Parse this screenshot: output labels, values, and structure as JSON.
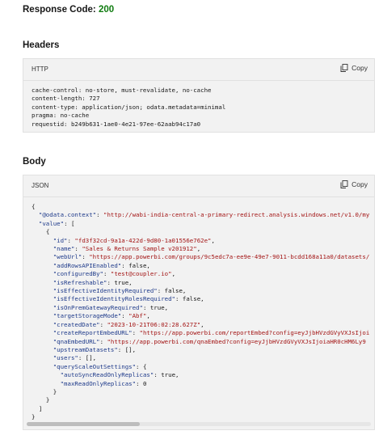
{
  "response": {
    "label": "Response Code: ",
    "code": "200"
  },
  "headers": {
    "title": "Headers",
    "lang": "HTTP",
    "copy_label": "Copy",
    "lines": [
      "cache-control: no-store, must-revalidate, no-cache",
      "content-length: 727",
      "content-type: application/json; odata.metadata=minimal",
      "pragma: no-cache",
      "requestid: b249b631-1ae0-4e21-97ee-62aab94c17a0"
    ]
  },
  "body": {
    "title": "Body",
    "lang": "JSON",
    "copy_label": "Copy",
    "lines": [
      {
        "t": "p",
        "v": "{"
      },
      {
        "i": "  ",
        "k": "\"@odata.context\"",
        "sep": ": ",
        "s": "\"http://wabi-india-central-a-primary-redirect.analysis.windows.net/v1.0/my"
      },
      {
        "i": "  ",
        "k": "\"value\"",
        "sep": ": ["
      },
      {
        "i": "    ",
        "t": "p",
        "v": "{"
      },
      {
        "i": "      ",
        "k": "\"id\"",
        "sep": ": ",
        "s": "\"fd3f32cd-9a1a-422d-9d80-1a01556e762e\"",
        "end": ","
      },
      {
        "i": "      ",
        "k": "\"name\"",
        "sep": ": ",
        "s": "\"Sales & Returns Sample v201912\"",
        "end": ","
      },
      {
        "i": "      ",
        "k": "\"webUrl\"",
        "sep": ": ",
        "s": "\"https://app.powerbi.com/groups/9c5edc7a-ee9e-49e7-9011-bcdd168a11a0/datasets/"
      },
      {
        "i": "      ",
        "k": "\"addRowsAPIEnabled\"",
        "sep": ": ",
        "n": "false",
        "end": ","
      },
      {
        "i": "      ",
        "k": "\"configuredBy\"",
        "sep": ": ",
        "s": "\"test@coupler.io\"",
        "end": ","
      },
      {
        "i": "      ",
        "k": "\"isRefreshable\"",
        "sep": ": ",
        "n": "true",
        "end": ","
      },
      {
        "i": "      ",
        "k": "\"isEffectiveIdentityRequired\"",
        "sep": ": ",
        "n": "false",
        "end": ","
      },
      {
        "i": "      ",
        "k": "\"isEffectiveIdentityRolesRequired\"",
        "sep": ": ",
        "n": "false",
        "end": ","
      },
      {
        "i": "      ",
        "k": "\"isOnPremGatewayRequired\"",
        "sep": ": ",
        "n": "true",
        "end": ","
      },
      {
        "i": "      ",
        "k": "\"targetStorageMode\"",
        "sep": ": ",
        "s": "\"Abf\"",
        "end": ","
      },
      {
        "i": "      ",
        "k": "\"createdDate\"",
        "sep": ": ",
        "s": "\"2023-10-21T06:02:28.627Z\"",
        "end": ","
      },
      {
        "i": "      ",
        "k": "\"createReportEmbedURL\"",
        "sep": ": ",
        "s": "\"https://app.powerbi.com/reportEmbed?config=eyJjbHVzdGVyVXJsIjoi"
      },
      {
        "i": "      ",
        "k": "\"qnaEmbedURL\"",
        "sep": ": ",
        "s": "\"https://app.powerbi.com/qnaEmbed?config=eyJjbHVzdGVyVXJsIjoiaHR0cHM6Ly9"
      },
      {
        "i": "      ",
        "k": "\"upstreamDatasets\"",
        "sep": ": [],"
      },
      {
        "i": "      ",
        "k": "\"users\"",
        "sep": ": [],"
      },
      {
        "i": "      ",
        "k": "\"queryScaleOutSettings\"",
        "sep": ": {"
      },
      {
        "i": "        ",
        "k": "\"autoSyncReadOnlyReplicas\"",
        "sep": ": ",
        "n": "true",
        "end": ","
      },
      {
        "i": "        ",
        "k": "\"maxReadOnlyReplicas\"",
        "sep": ": ",
        "n": "0"
      },
      {
        "i": "      ",
        "t": "p",
        "v": "}"
      },
      {
        "i": "    ",
        "t": "p",
        "v": "}"
      },
      {
        "i": "  ",
        "t": "p",
        "v": "]"
      },
      {
        "t": "p",
        "v": "}"
      }
    ],
    "scroll_position": 0
  },
  "colors": {
    "success": "#107c10",
    "key": "#1e3a8a",
    "string": "#a31515"
  },
  "icons": {
    "copy": "copy-icon"
  }
}
